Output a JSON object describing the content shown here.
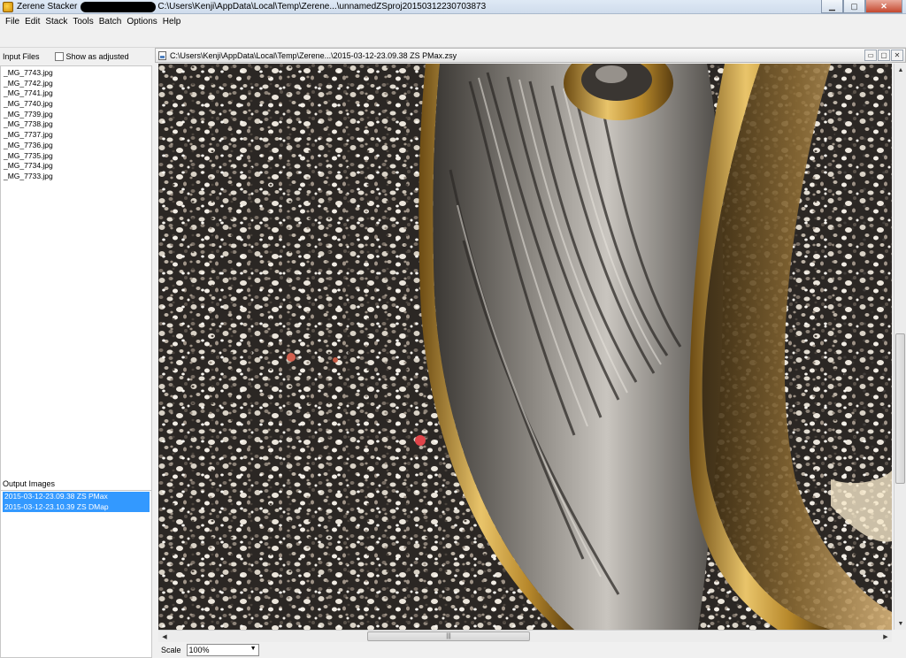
{
  "window": {
    "app_name": "Zerene Stacker",
    "path": "C:\\Users\\Kenji\\AppData\\Local\\Temp\\Zerene...\\unnamedZSproj20150312230703873",
    "minimize_glyph": "▁",
    "maximize_glyph": "▢",
    "close_glyph": "✕"
  },
  "menu": [
    "File",
    "Edit",
    "Stack",
    "Tools",
    "Batch",
    "Options",
    "Help"
  ],
  "input_panel": {
    "title": "Input Files",
    "show_adjusted_label": "Show as adjusted",
    "show_adjusted_checked": false,
    "files": [
      "_MG_7743.jpg",
      "_MG_7742.jpg",
      "_MG_7741.jpg",
      "_MG_7740.jpg",
      "_MG_7739.jpg",
      "_MG_7738.jpg",
      "_MG_7737.jpg",
      "_MG_7736.jpg",
      "_MG_7735.jpg",
      "_MG_7734.jpg",
      "_MG_7733.jpg"
    ]
  },
  "output_panel": {
    "title": "Output Images",
    "items": [
      "2015-03-12-23.09.38 ZS PMax",
      "2015-03-12-23.10.39 ZS DMap"
    ]
  },
  "image_frame": {
    "path": "C:\\Users\\Kenji\\AppData\\Local\\Temp\\Zerene...\\2015-03-12-23.09.38 ZS PMax.zsy",
    "min_glyph": "▭",
    "max_glyph": "▢",
    "close_glyph": "✕",
    "image_subject": "macro photo of a damascus-patterned ring with gold inlay resting on speckled sand"
  },
  "scale": {
    "label": "Scale",
    "value": "100%"
  },
  "icons": {
    "app": "zerene-app-icon",
    "doc": "document-icon",
    "dropdown": "chevron-down-icon"
  }
}
